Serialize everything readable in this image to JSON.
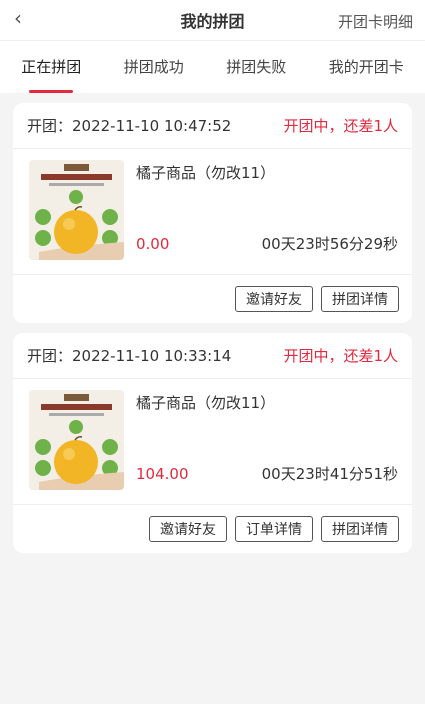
{
  "header": {
    "back_icon": "chevron-left-icon",
    "title": "我的拼团",
    "right_link": "开团卡明细"
  },
  "tabs": [
    {
      "label": "正在拼团",
      "active": true
    },
    {
      "label": "拼团成功",
      "active": false
    },
    {
      "label": "拼团失败",
      "active": false
    },
    {
      "label": "我的开团卡",
      "active": false
    }
  ],
  "orders": [
    {
      "open_label": "开团：2022-11-10 10:47:52",
      "status": "开团中，还差1人",
      "product_name": "橘子商品（勿改11）",
      "price": "0.00",
      "countdown": "00天23时56分29秒",
      "buttons": [
        "邀请好友",
        "拼团详情"
      ]
    },
    {
      "open_label": "开团：2022-11-10 10:33:14",
      "status": "开团中，还差1人",
      "product_name": "橘子商品（勿改11）",
      "price": "104.00",
      "countdown": "00天23时41分51秒",
      "buttons": [
        "邀请好友",
        "订单详情",
        "拼团详情"
      ]
    }
  ],
  "colors": {
    "accent": "#e3293e",
    "background": "#f4f4f4"
  }
}
